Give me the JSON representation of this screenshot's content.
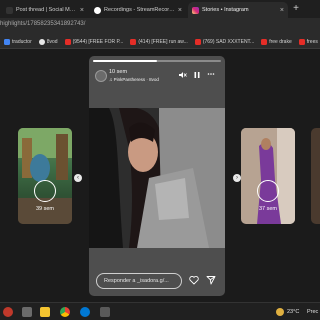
{
  "browser": {
    "tabs": [
      {
        "label": "Post thread | Social Media Girls",
        "active": false
      },
      {
        "label": "Recordings - StreamRecorder",
        "active": false
      },
      {
        "label": "Stories • Instagram",
        "active": true
      }
    ],
    "new_tab_glyph": "+",
    "close_glyph": "×",
    "url": "highlights/17858235341892743/"
  },
  "bookmarks": [
    {
      "label": "traductor",
      "icon": "translate-icon"
    },
    {
      "label": "8vod",
      "icon": "site-icon"
    },
    {
      "label": "(9544) [FREE FOR P...",
      "icon": "youtube-icon"
    },
    {
      "label": "(414) [FREE] run aw...",
      "icon": "youtube-icon"
    },
    {
      "label": "(769) SAD XXXTENT...",
      "icon": "youtube-icon"
    },
    {
      "label": "free drake",
      "icon": "youtube-icon"
    },
    {
      "label": "frees",
      "icon": "youtube-icon"
    }
  ],
  "stories": {
    "left": {
      "time": "39 sem"
    },
    "right": {
      "time": "37 sem"
    },
    "main": {
      "time": "10 sem",
      "track": "PinkPantheress · 8vod",
      "progress": 0.5,
      "reply_placeholder": "Responder a _isadora.g/..."
    },
    "nav_prev_glyph": "‹",
    "nav_next_glyph": "›"
  },
  "taskbar": {
    "temperature": "23°C",
    "weather_text": "Prec"
  },
  "colors": {
    "instagram_tab_icon": "#d6249f",
    "youtube_red": "#e52d27",
    "page_bg": "#1b1b1b",
    "left_story_tint": "#4f8f4d",
    "right_story_tint": "#7a3a9a"
  }
}
